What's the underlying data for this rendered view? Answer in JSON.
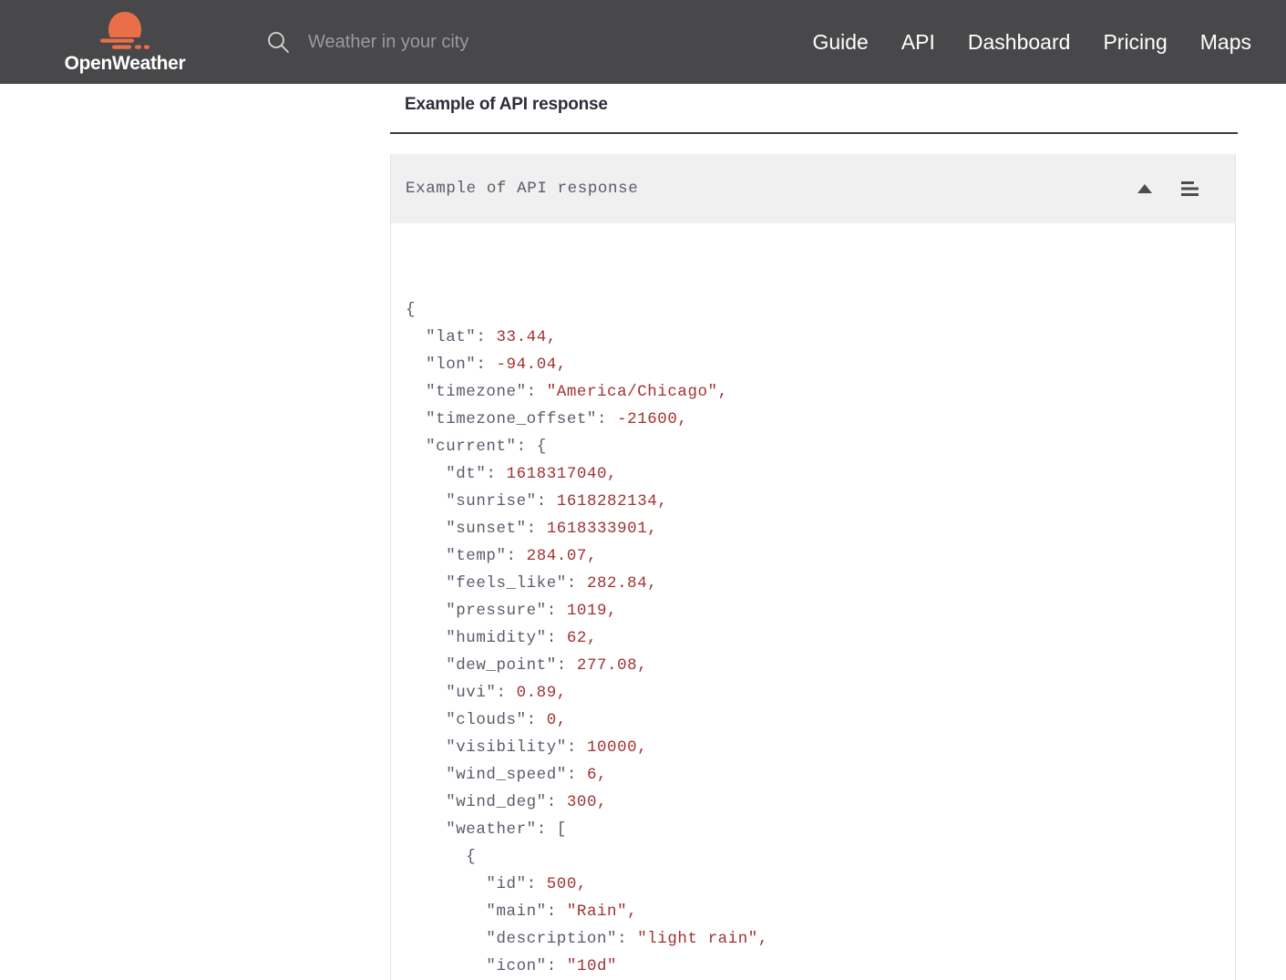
{
  "navbar": {
    "brand_name": "OpenWeather",
    "brand_icon": "sun-cloud-logo-icon",
    "brand_color": "#eb6e4b",
    "background_color": "#48484a",
    "search": {
      "icon": "search-icon",
      "placeholder": "Weather in your city",
      "value": ""
    },
    "links": [
      {
        "label": "Guide"
      },
      {
        "label": "API"
      },
      {
        "label": "Dashboard"
      },
      {
        "label": "Pricing"
      },
      {
        "label": "Maps"
      }
    ]
  },
  "main": {
    "page_title": "Example of API response",
    "code_block": {
      "header_title": "Example of API response",
      "collapse_icon": "triangle-up-icon",
      "menu_icon": "hamburger-menu-icon",
      "header_background": "#f0f0f0",
      "key_color": "#5b5b6b",
      "value_color": "#a03232",
      "lines": [
        {
          "indent": 0,
          "text": "{",
          "type": "punct"
        },
        {
          "indent": 1,
          "key": "\"lat\"",
          "value": "33.44,"
        },
        {
          "indent": 1,
          "key": "\"lon\"",
          "value": "-94.04,"
        },
        {
          "indent": 1,
          "key": "\"timezone\"",
          "value": "\"America/Chicago\","
        },
        {
          "indent": 1,
          "key": "\"timezone_offset\"",
          "value": "-21600,"
        },
        {
          "indent": 1,
          "key": "\"current\"",
          "value": "{",
          "value_type": "punct"
        },
        {
          "indent": 2,
          "key": "\"dt\"",
          "value": "1618317040,"
        },
        {
          "indent": 2,
          "key": "\"sunrise\"",
          "value": "1618282134,"
        },
        {
          "indent": 2,
          "key": "\"sunset\"",
          "value": "1618333901,"
        },
        {
          "indent": 2,
          "key": "\"temp\"",
          "value": "284.07,"
        },
        {
          "indent": 2,
          "key": "\"feels_like\"",
          "value": "282.84,"
        },
        {
          "indent": 2,
          "key": "\"pressure\"",
          "value": "1019,"
        },
        {
          "indent": 2,
          "key": "\"humidity\"",
          "value": "62,"
        },
        {
          "indent": 2,
          "key": "\"dew_point\"",
          "value": "277.08,"
        },
        {
          "indent": 2,
          "key": "\"uvi\"",
          "value": "0.89,"
        },
        {
          "indent": 2,
          "key": "\"clouds\"",
          "value": "0,"
        },
        {
          "indent": 2,
          "key": "\"visibility\"",
          "value": "10000,"
        },
        {
          "indent": 2,
          "key": "\"wind_speed\"",
          "value": "6,"
        },
        {
          "indent": 2,
          "key": "\"wind_deg\"",
          "value": "300,"
        },
        {
          "indent": 2,
          "key": "\"weather\"",
          "value": "[",
          "value_type": "punct"
        },
        {
          "indent": 3,
          "text": "{",
          "type": "punct"
        },
        {
          "indent": 4,
          "key": "\"id\"",
          "value": "500,"
        },
        {
          "indent": 4,
          "key": "\"main\"",
          "value": "\"Rain\","
        },
        {
          "indent": 4,
          "key": "\"description\"",
          "value": "\"light rain\","
        },
        {
          "indent": 4,
          "key": "\"icon\"",
          "value": "\"10d\""
        }
      ]
    }
  }
}
